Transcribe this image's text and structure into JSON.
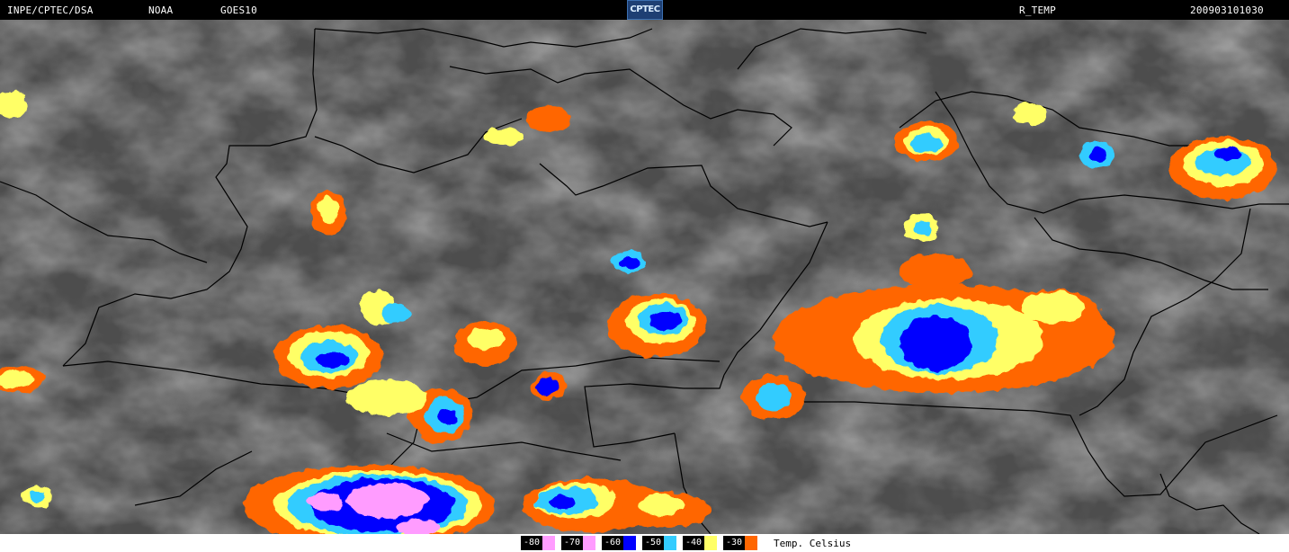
{
  "header": {
    "source": "INPE/CPTEC/DSA",
    "agency": "NOAA",
    "satellite": "GOES10",
    "logo_text": "CPTEC",
    "product": "R_TEMP",
    "timestamp": "200903101030"
  },
  "legend": {
    "unit": "Temp. Celsius",
    "items": [
      {
        "label": "-80",
        "color": "#ff9cff"
      },
      {
        "label": "-70",
        "color": "#ff9cff"
      },
      {
        "label": "-60",
        "color": "#0000ff"
      },
      {
        "label": "-50",
        "color": "#33ccff"
      },
      {
        "label": "-40",
        "color": "#ffff66"
      },
      {
        "label": "-30",
        "color": "#ff6600"
      }
    ]
  },
  "map": {
    "background_color": "#4d4d4d",
    "border_color": "#000000"
  }
}
